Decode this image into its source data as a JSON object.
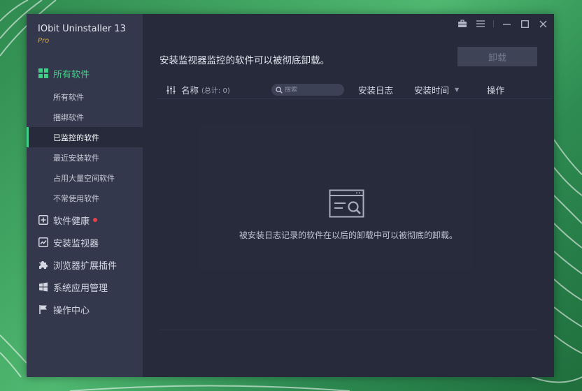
{
  "app": {
    "title": "IObit Uninstaller 13",
    "edition": "Pro"
  },
  "colors": {
    "accent": "#3fcf86",
    "sidebar_bg": "#33384c",
    "main_bg": "#262a3b",
    "notification_dot": "#e8414b",
    "edition": "#d9a93a"
  },
  "sidebar": {
    "main_items": [
      {
        "label": "所有软件",
        "icon": "grid-icon",
        "active": true
      },
      {
        "label": "软件健康",
        "icon": "health-plus-icon",
        "badge": "red-dot"
      },
      {
        "label": "安装监视器",
        "icon": "monitor-chart-icon"
      },
      {
        "label": "浏览器扩展插件",
        "icon": "puzzle-icon"
      },
      {
        "label": "系统应用管理",
        "icon": "windows-icon"
      },
      {
        "label": "操作中心",
        "icon": "flag-icon"
      }
    ],
    "sub_items": [
      {
        "label": "所有软件"
      },
      {
        "label": "捆绑软件"
      },
      {
        "label": "已监控的软件",
        "active": true
      },
      {
        "label": "最近安装软件"
      },
      {
        "label": "占用大量空间软件"
      },
      {
        "label": "不常使用软件"
      }
    ]
  },
  "window_controls": {
    "icons": [
      "toolbox-icon",
      "menu-icon",
      "minimize-icon",
      "maximize-icon",
      "close-icon"
    ]
  },
  "main": {
    "headline": "安装监视器监控的软件可以被彻底卸载。",
    "uninstall_label": "卸载",
    "table": {
      "name_label": "名称",
      "total_label": "(总计: 0)",
      "search_placeholder": "搜索",
      "log_label": "安装日志",
      "time_label": "安装时间",
      "action_label": "操作"
    },
    "empty_message": "被安装日志记录的软件在以后的卸载中可以被彻底的卸载。"
  }
}
